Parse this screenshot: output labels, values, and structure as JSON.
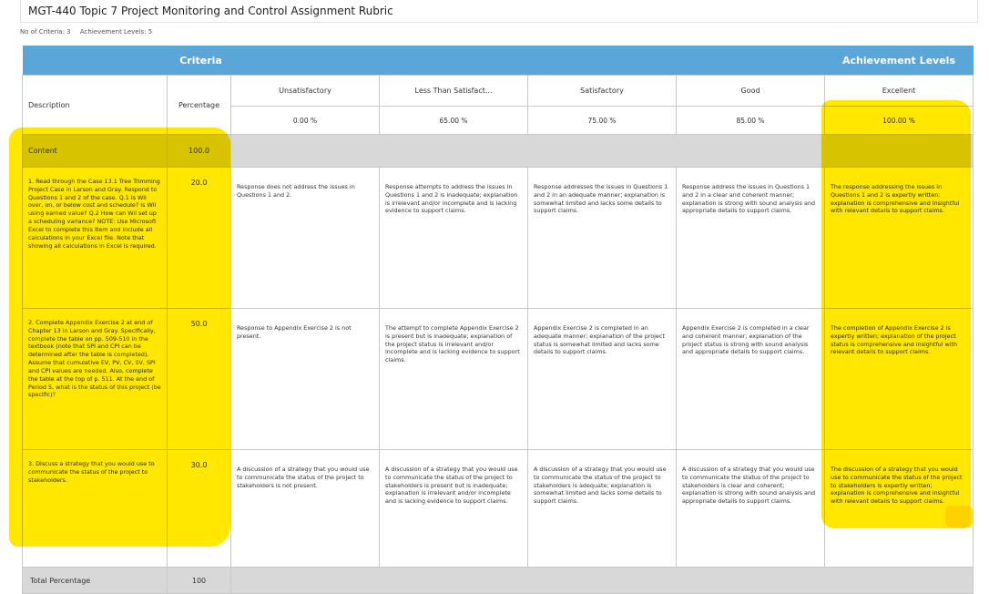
{
  "title": "MGT-440 Topic 7 Project Monitoring and Control Assignment Rubric",
  "meta": {
    "criteria_count": "No of Criteria: 3",
    "achievement_levels": "Achievement Levels: 5"
  },
  "band": {
    "criteria": "Criteria",
    "achievement_levels": "Achievement Levels"
  },
  "headers": {
    "description": "Description",
    "percentage": "Percentage",
    "levels": [
      "Unsatisfactory",
      "Less Than Satisfact...",
      "Satisfactory",
      "Good",
      "Excellent"
    ]
  },
  "level_percentages": [
    "0.00 %",
    "65.00 %",
    "75.00 %",
    "85.00 %",
    "100.00 %"
  ],
  "section": {
    "name": "Content",
    "weight": "100.0"
  },
  "criteria": [
    {
      "description": "1. Read through the Case 13.1 Tree Trimming Project Case in Larson and Gray. Respond to Questions 1 and 2 of the case. Q.1 Is Wil over, on, or below cost and schedule? Is Wil using earned value? Q.2 How can Wil set up a scheduling variance? NOTE: Use Microsoft Excel to complete this item and include all calculations in your Excel file. Note that showing all calculations in Excel is required.",
      "weight": "20.0",
      "levels": [
        "Response does not address the issues in Questions 1 and 2.",
        "Response attempts to address the issues in Questions 1 and 2 is inadequate; explanation is irrelevant and/or incomplete and is lacking evidence to support claims.",
        "Response addresses the issues in Questions 1 and 2 in an adequate manner; explanation is somewhat limited and lacks some details to support claims.",
        "Response address the issues in Questions 1 and 2 in a clear and coherent manner; explanation is strong with sound analysis and appropriate details to support claims.",
        "The response addressing the issues in Questions 1 and 2 is expertly written; explanation is comprehensive and insightful with relevant details to support claims."
      ]
    },
    {
      "description": "2. Complete Appendix Exercise 2 at end of Chapter 13 in Larson and Gray. Specifically, complete the table on pp. 509-510 in the textbook (note that SPI and CPI can be determined after the table is completed). Assume that cumulative EV, PV, CV, SV, SPI and CPI values are needed. Also, complete the table at the top of p. 511. At the end of Period 5, what is the status of this project (be specific)?",
      "weight": "50.0",
      "levels": [
        "Response to Appendix Exercise 2 is not present.",
        "The attempt to complete Appendix Exercise 2 is present but is inadequate; explanation of the project status is irrelevant and/or incomplete and is lacking evidence to support claims.",
        "Appendix Exercise 2 is completed in an adequate manner; explanation of the project status is somewhat limited and lacks some details to support claims.",
        "Appendix Exercise 2 is completed in a clear and coherent manner; explanation of the project status is strong with sound analysis and appropriate details to support claims.",
        "The completion of Appendix Exercise 2 is expertly written; explanation of the project status is comprehensive and insightful with relevant details to support claims."
      ]
    },
    {
      "description": "3. Discuss a strategy that you would use to communicate the status of the project to stakeholders.",
      "weight": "30.0",
      "levels": [
        "A discussion of a strategy that you would use to communicate the status of the project to stakeholders is not present.",
        "A discussion of a strategy that you would use to communicate the status of the project to stakeholders is present but is inadequate; explanation is irrelevant and/or incomplete and is lacking evidence to support claims.",
        "A discussion of a strategy that you would use to communicate the status of the project to stakeholders is adequate; explanation is somewhat limited and lacks some details to support claims.",
        "A discussion of a strategy that you would use to communicate the status of the project to stakeholders is clear and coherent; explanation is strong with sound analysis and appropriate details to support claims.",
        "The discussion of a strategy that you would use to communicate the status of the project to stakeholders is expertly written; explanation is comprehensive and insightful with relevant details to support claims."
      ]
    }
  ],
  "total": {
    "label": "Total Percentage",
    "value": "100"
  },
  "highlight_color": "#ffe700",
  "header_band_color": "#5aa6d8",
  "section_bg_color": "#d8d8d8"
}
